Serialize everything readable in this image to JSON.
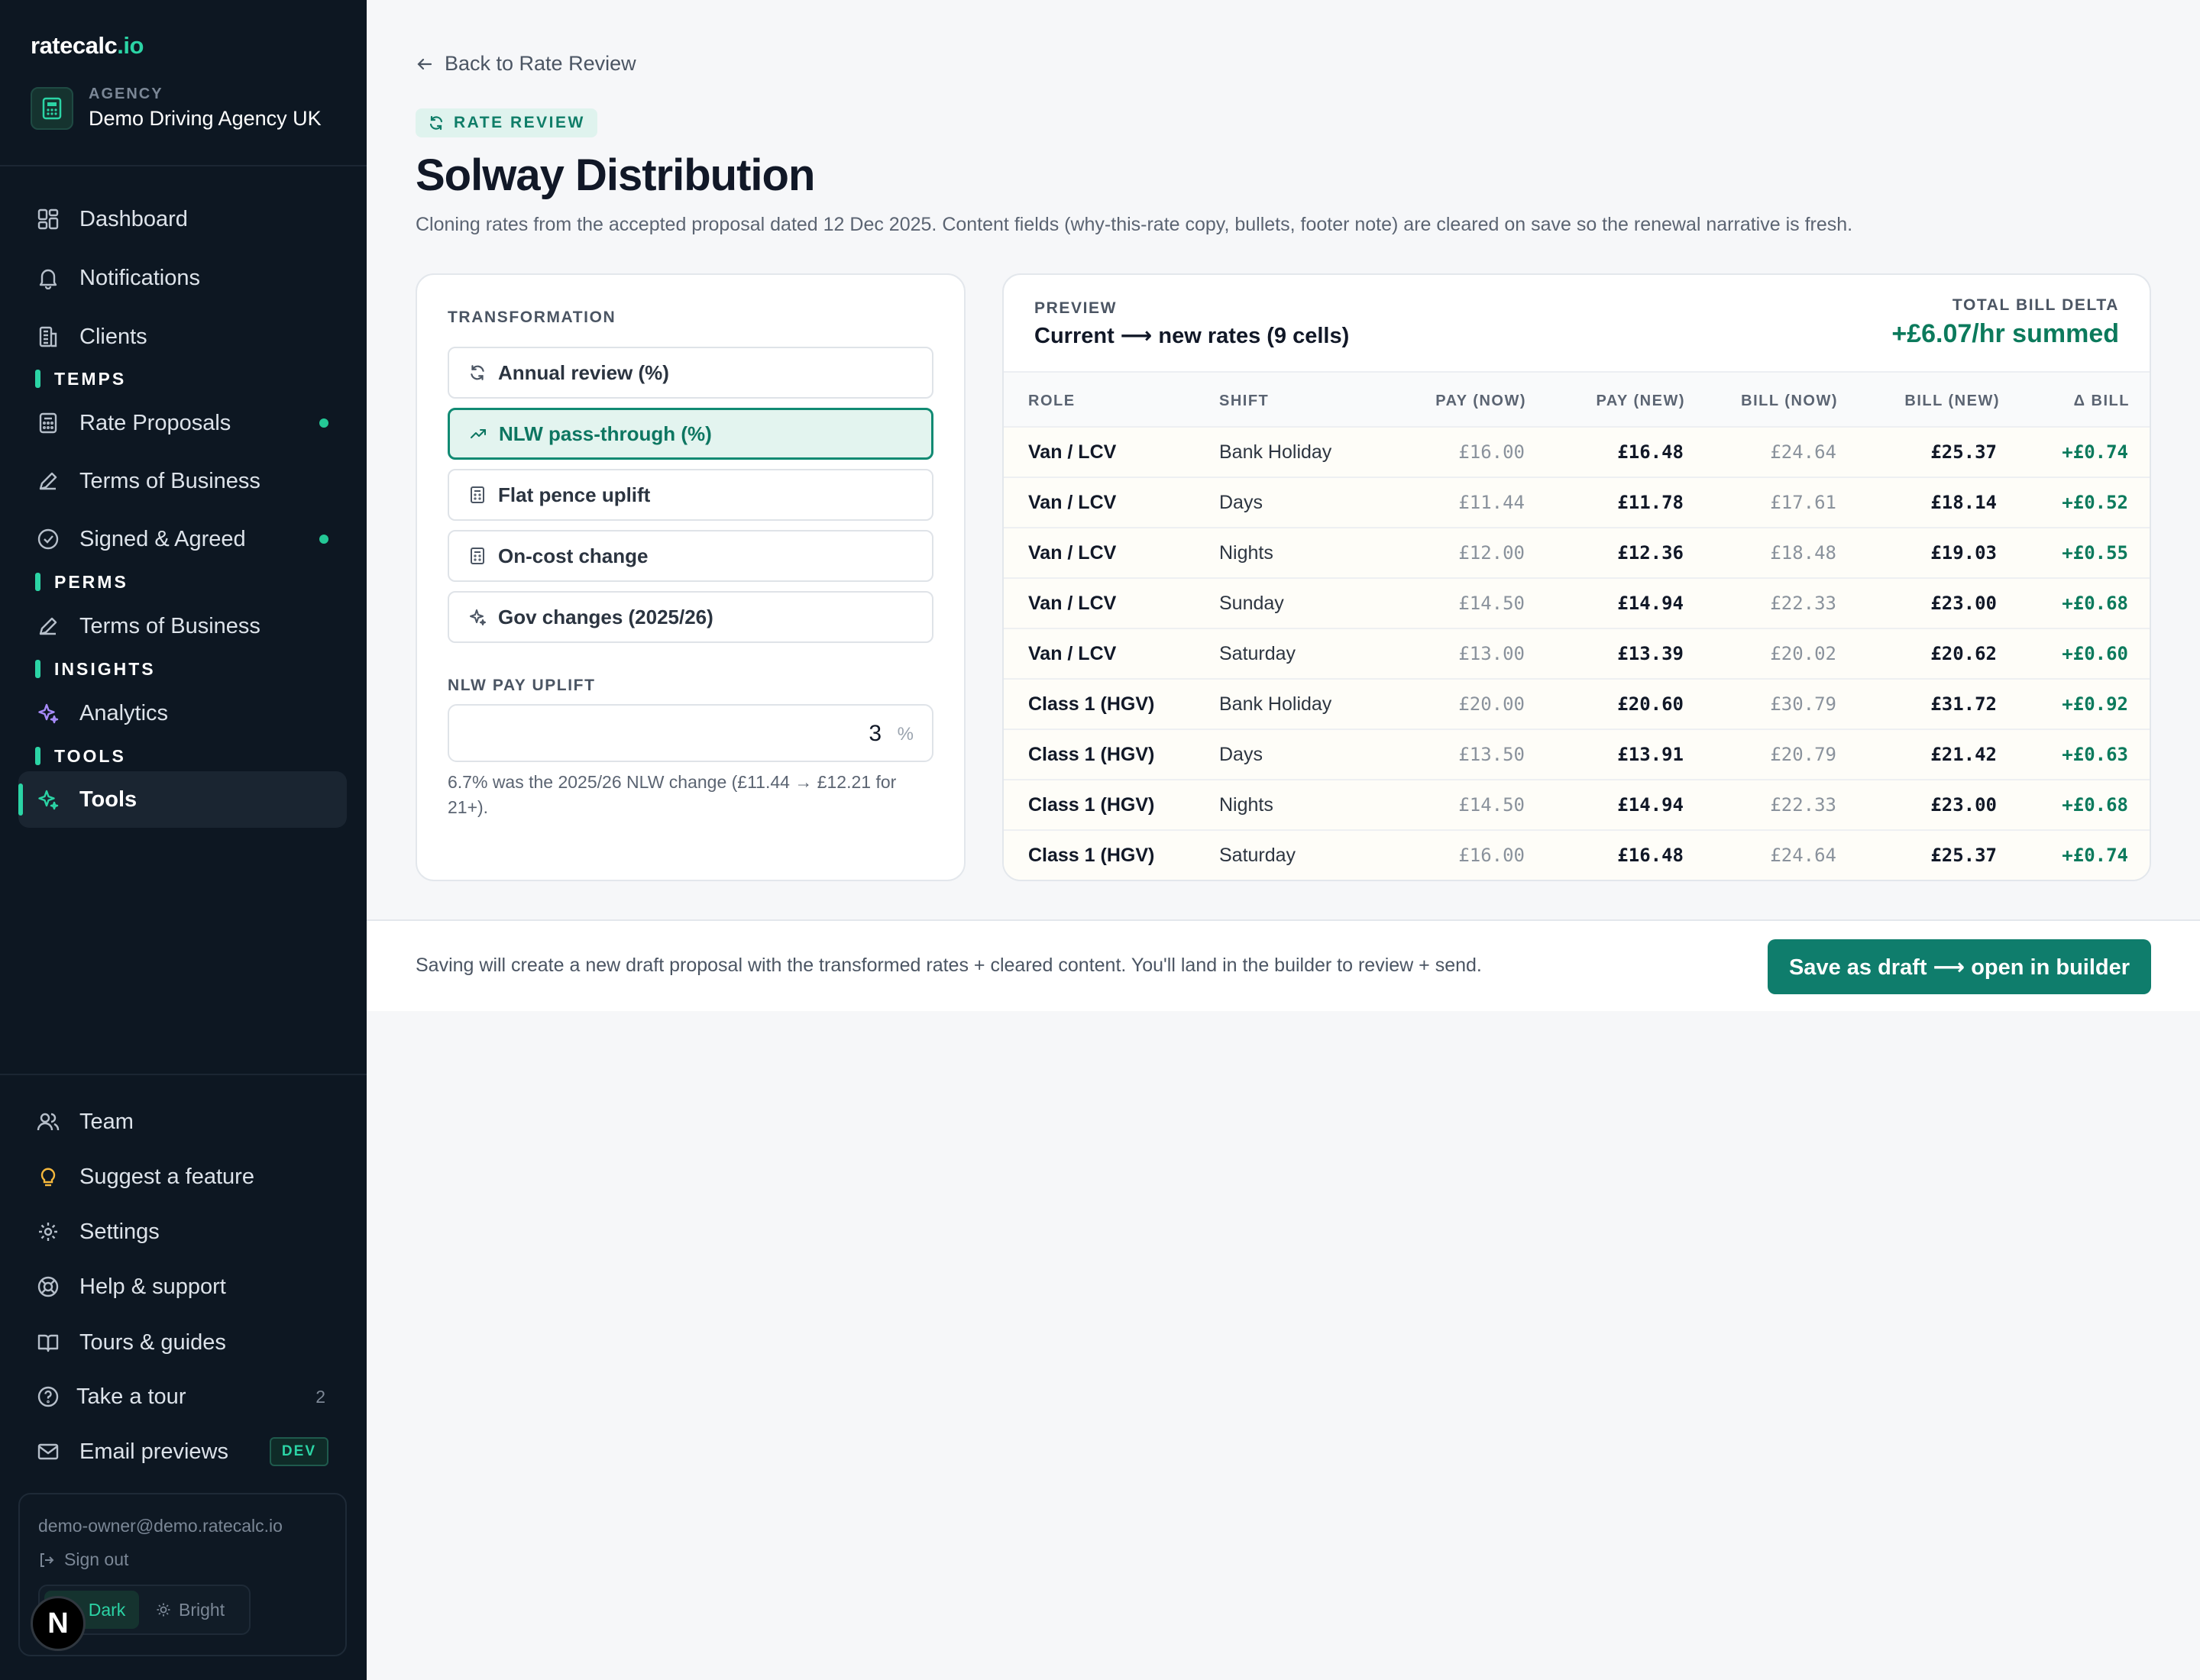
{
  "brand": {
    "name": "ratecalc",
    "tld": ".io"
  },
  "agency": {
    "kicker": "AGENCY",
    "name": "Demo Driving Agency UK"
  },
  "nav": {
    "dashboard": "Dashboard",
    "notifications": "Notifications",
    "clients": "Clients",
    "temps_section": "TEMPS",
    "rate_proposals": "Rate Proposals",
    "terms_of_business_temps": "Terms of Business",
    "signed_agreed": "Signed & Agreed",
    "perms_section": "PERMS",
    "terms_of_business_perms": "Terms of Business",
    "insights_section": "INSIGHTS",
    "analytics": "Analytics",
    "tools_section": "TOOLS",
    "tools": "Tools"
  },
  "bottom_nav": {
    "team": "Team",
    "suggest": "Suggest a feature",
    "settings": "Settings",
    "help": "Help & support",
    "tours": "Tours & guides",
    "take_tour": "Take a tour",
    "take_tour_count": "2",
    "email_previews": "Email previews",
    "dev_badge": "DEV"
  },
  "account": {
    "email": "demo-owner@demo.ratecalc.io",
    "sign_out": "Sign out",
    "theme_dark": "Dark",
    "theme_bright": "Bright",
    "avatar_letter": "N"
  },
  "header": {
    "back_link": "Back to Rate Review",
    "pill": "RATE REVIEW",
    "title": "Solway Distribution",
    "subtitle": "Cloning rates from the accepted proposal dated 12 Dec 2025. Content fields (why-this-rate copy, bullets, footer note) are cleared on save so the renewal narrative is fresh."
  },
  "transformation": {
    "label": "TRANSFORMATION",
    "options": [
      {
        "label": "Annual review (%)",
        "icon": "refresh-icon",
        "selected": false
      },
      {
        "label": "NLW pass-through (%)",
        "icon": "trend-up-icon",
        "selected": true
      },
      {
        "label": "Flat pence uplift",
        "icon": "calculator-icon",
        "selected": false
      },
      {
        "label": "On-cost change",
        "icon": "calculator-icon",
        "selected": false
      },
      {
        "label": "Gov changes (2025/26)",
        "icon": "sparkle-icon",
        "selected": false
      }
    ],
    "uplift_label": "NLW PAY UPLIFT",
    "uplift_value": "3",
    "uplift_unit": "%",
    "uplift_hint": "6.7% was the 2025/26 NLW change (£11.44 → £12.21 for 21+)."
  },
  "preview": {
    "kicker": "PREVIEW",
    "title": "Current ⟶ new rates (9 cells)",
    "delta_kicker": "TOTAL BILL DELTA",
    "delta_value": "+£6.07/hr summed",
    "columns": [
      "ROLE",
      "SHIFT",
      "PAY (NOW)",
      "PAY (NEW)",
      "BILL (NOW)",
      "BILL (NEW)",
      "Δ BILL"
    ],
    "rows": [
      [
        "Van / LCV",
        "Bank Holiday",
        "£16.00",
        "£16.48",
        "£24.64",
        "£25.37",
        "+£0.74"
      ],
      [
        "Van / LCV",
        "Days",
        "£11.44",
        "£11.78",
        "£17.61",
        "£18.14",
        "+£0.52"
      ],
      [
        "Van / LCV",
        "Nights",
        "£12.00",
        "£12.36",
        "£18.48",
        "£19.03",
        "+£0.55"
      ],
      [
        "Van / LCV",
        "Sunday",
        "£14.50",
        "£14.94",
        "£22.33",
        "£23.00",
        "+£0.68"
      ],
      [
        "Van / LCV",
        "Saturday",
        "£13.00",
        "£13.39",
        "£20.02",
        "£20.62",
        "+£0.60"
      ],
      [
        "Class 1 (HGV)",
        "Bank Holiday",
        "£20.00",
        "£20.60",
        "£30.79",
        "£31.72",
        "+£0.92"
      ],
      [
        "Class 1 (HGV)",
        "Days",
        "£13.50",
        "£13.91",
        "£20.79",
        "£21.42",
        "+£0.63"
      ],
      [
        "Class 1 (HGV)",
        "Nights",
        "£14.50",
        "£14.94",
        "£22.33",
        "£23.00",
        "+£0.68"
      ],
      [
        "Class 1 (HGV)",
        "Saturday",
        "£16.00",
        "£16.48",
        "£24.64",
        "£25.37",
        "+£0.74"
      ]
    ]
  },
  "footer": {
    "text": "Saving will create a new draft proposal with the transformed rates + cleared content. You'll land in the builder to review + send.",
    "save_button": "Save as draft ⟶ open in builder"
  },
  "colors": {
    "accent": "#0f7d6c",
    "sidebar_bg": "#0d1722",
    "positive": "#0c7a5c"
  }
}
